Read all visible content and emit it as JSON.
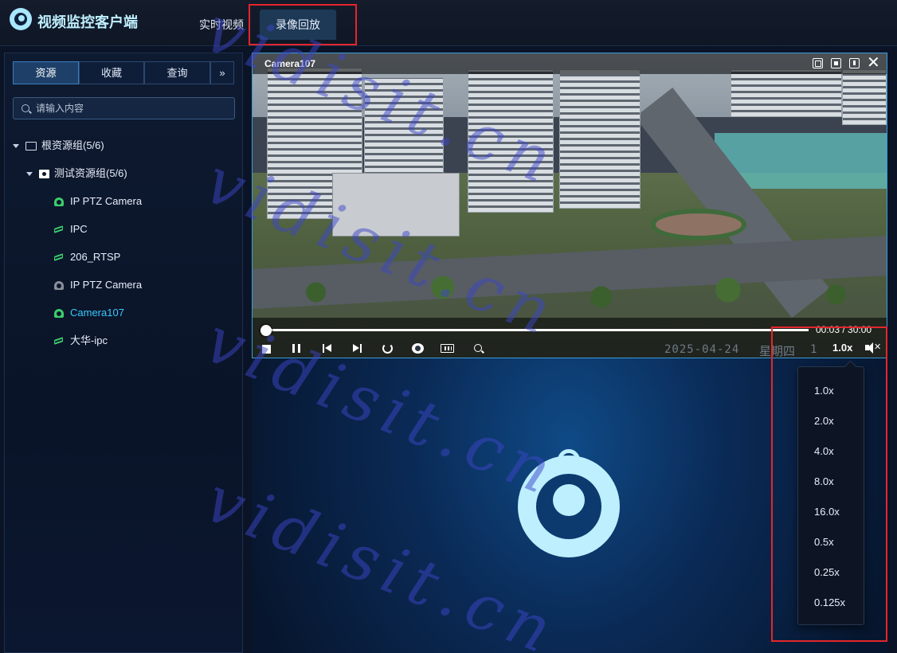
{
  "header": {
    "app_title": "视频监控客户端",
    "tabs": [
      {
        "label": "实时视频"
      },
      {
        "label": "录像回放"
      }
    ]
  },
  "sidebar": {
    "tabs": [
      {
        "label": "资源"
      },
      {
        "label": "收藏"
      },
      {
        "label": "查询"
      },
      {
        "label": "»"
      }
    ],
    "search_placeholder": "请输入内容",
    "tree": {
      "root": "根资源组(5/6)",
      "group": "测试资源组(5/6)",
      "devices": [
        {
          "label": "IP PTZ Camera",
          "icon": "dome-camera-icon",
          "online": true
        },
        {
          "label": "IPC",
          "icon": "bullet-camera-icon",
          "online": true
        },
        {
          "label": "206_RTSP",
          "icon": "bullet-camera-icon",
          "online": true
        },
        {
          "label": "IP PTZ Camera",
          "icon": "dome-camera-icon",
          "online": false
        },
        {
          "label": "Camera107",
          "icon": "dome-camera-icon",
          "online": true,
          "selected": true
        },
        {
          "label": "大华-ipc",
          "icon": "bullet-camera-icon",
          "online": true
        }
      ]
    }
  },
  "player": {
    "camera_title": "Camera107",
    "time_display": "00:03 / 30:00",
    "osd_date": "2025-04-24",
    "osd_weekday": "星期四",
    "osd_time": "1",
    "speed": "1.0x",
    "progress": 0.004
  },
  "speed_menu": {
    "options": [
      "1.0x",
      "2.0x",
      "4.0x",
      "8.0x",
      "16.0x",
      "0.5x",
      "0.25x",
      "0.125x"
    ]
  },
  "watermark": "vidisit.cn",
  "colors": {
    "accent": "#38c8ff",
    "highlight": "#e5262b",
    "online": "#3ccf6a",
    "offline": "#8a8f98"
  }
}
